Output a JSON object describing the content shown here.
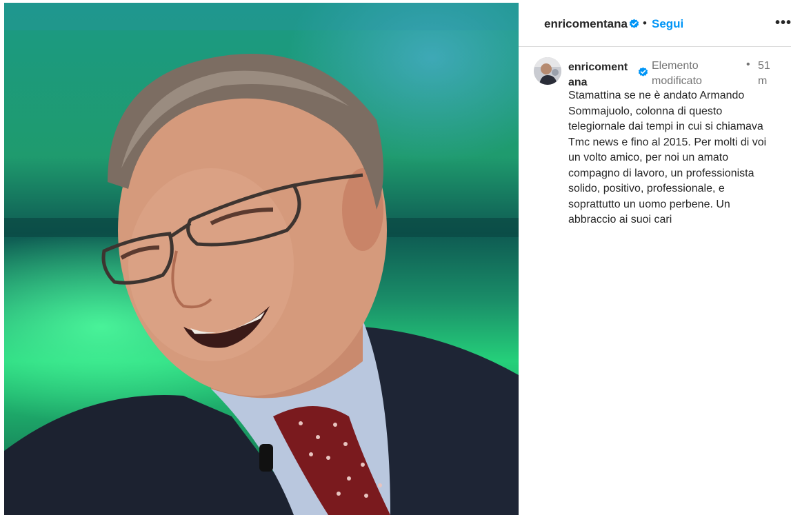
{
  "header": {
    "username": "enricomentana",
    "separator": "•",
    "follow_label": "Segui",
    "more_label": "•••"
  },
  "caption": {
    "username": "enricomentana",
    "edited_label": "Elemento modificato",
    "separator": "•",
    "time": "51 m",
    "text": "Stamattina se ne è andato Armando Sommajuolo, colonna di questo telegiornale dai tempi in cui si chiamava Tmc news e fino al 2015. Per molti di voi un volto amico, per noi un amato compagno di lavoro, un professionista solido, positivo, professionale, e soprattutto un uomo perbene. Un abbraccio ai suoi cari"
  },
  "icons": {
    "verified": "verified-badge-icon",
    "more": "more-options-icon"
  },
  "colors": {
    "accent": "#0095f6",
    "text": "#262626",
    "muted": "#737373",
    "divider": "#dbdbdb"
  }
}
